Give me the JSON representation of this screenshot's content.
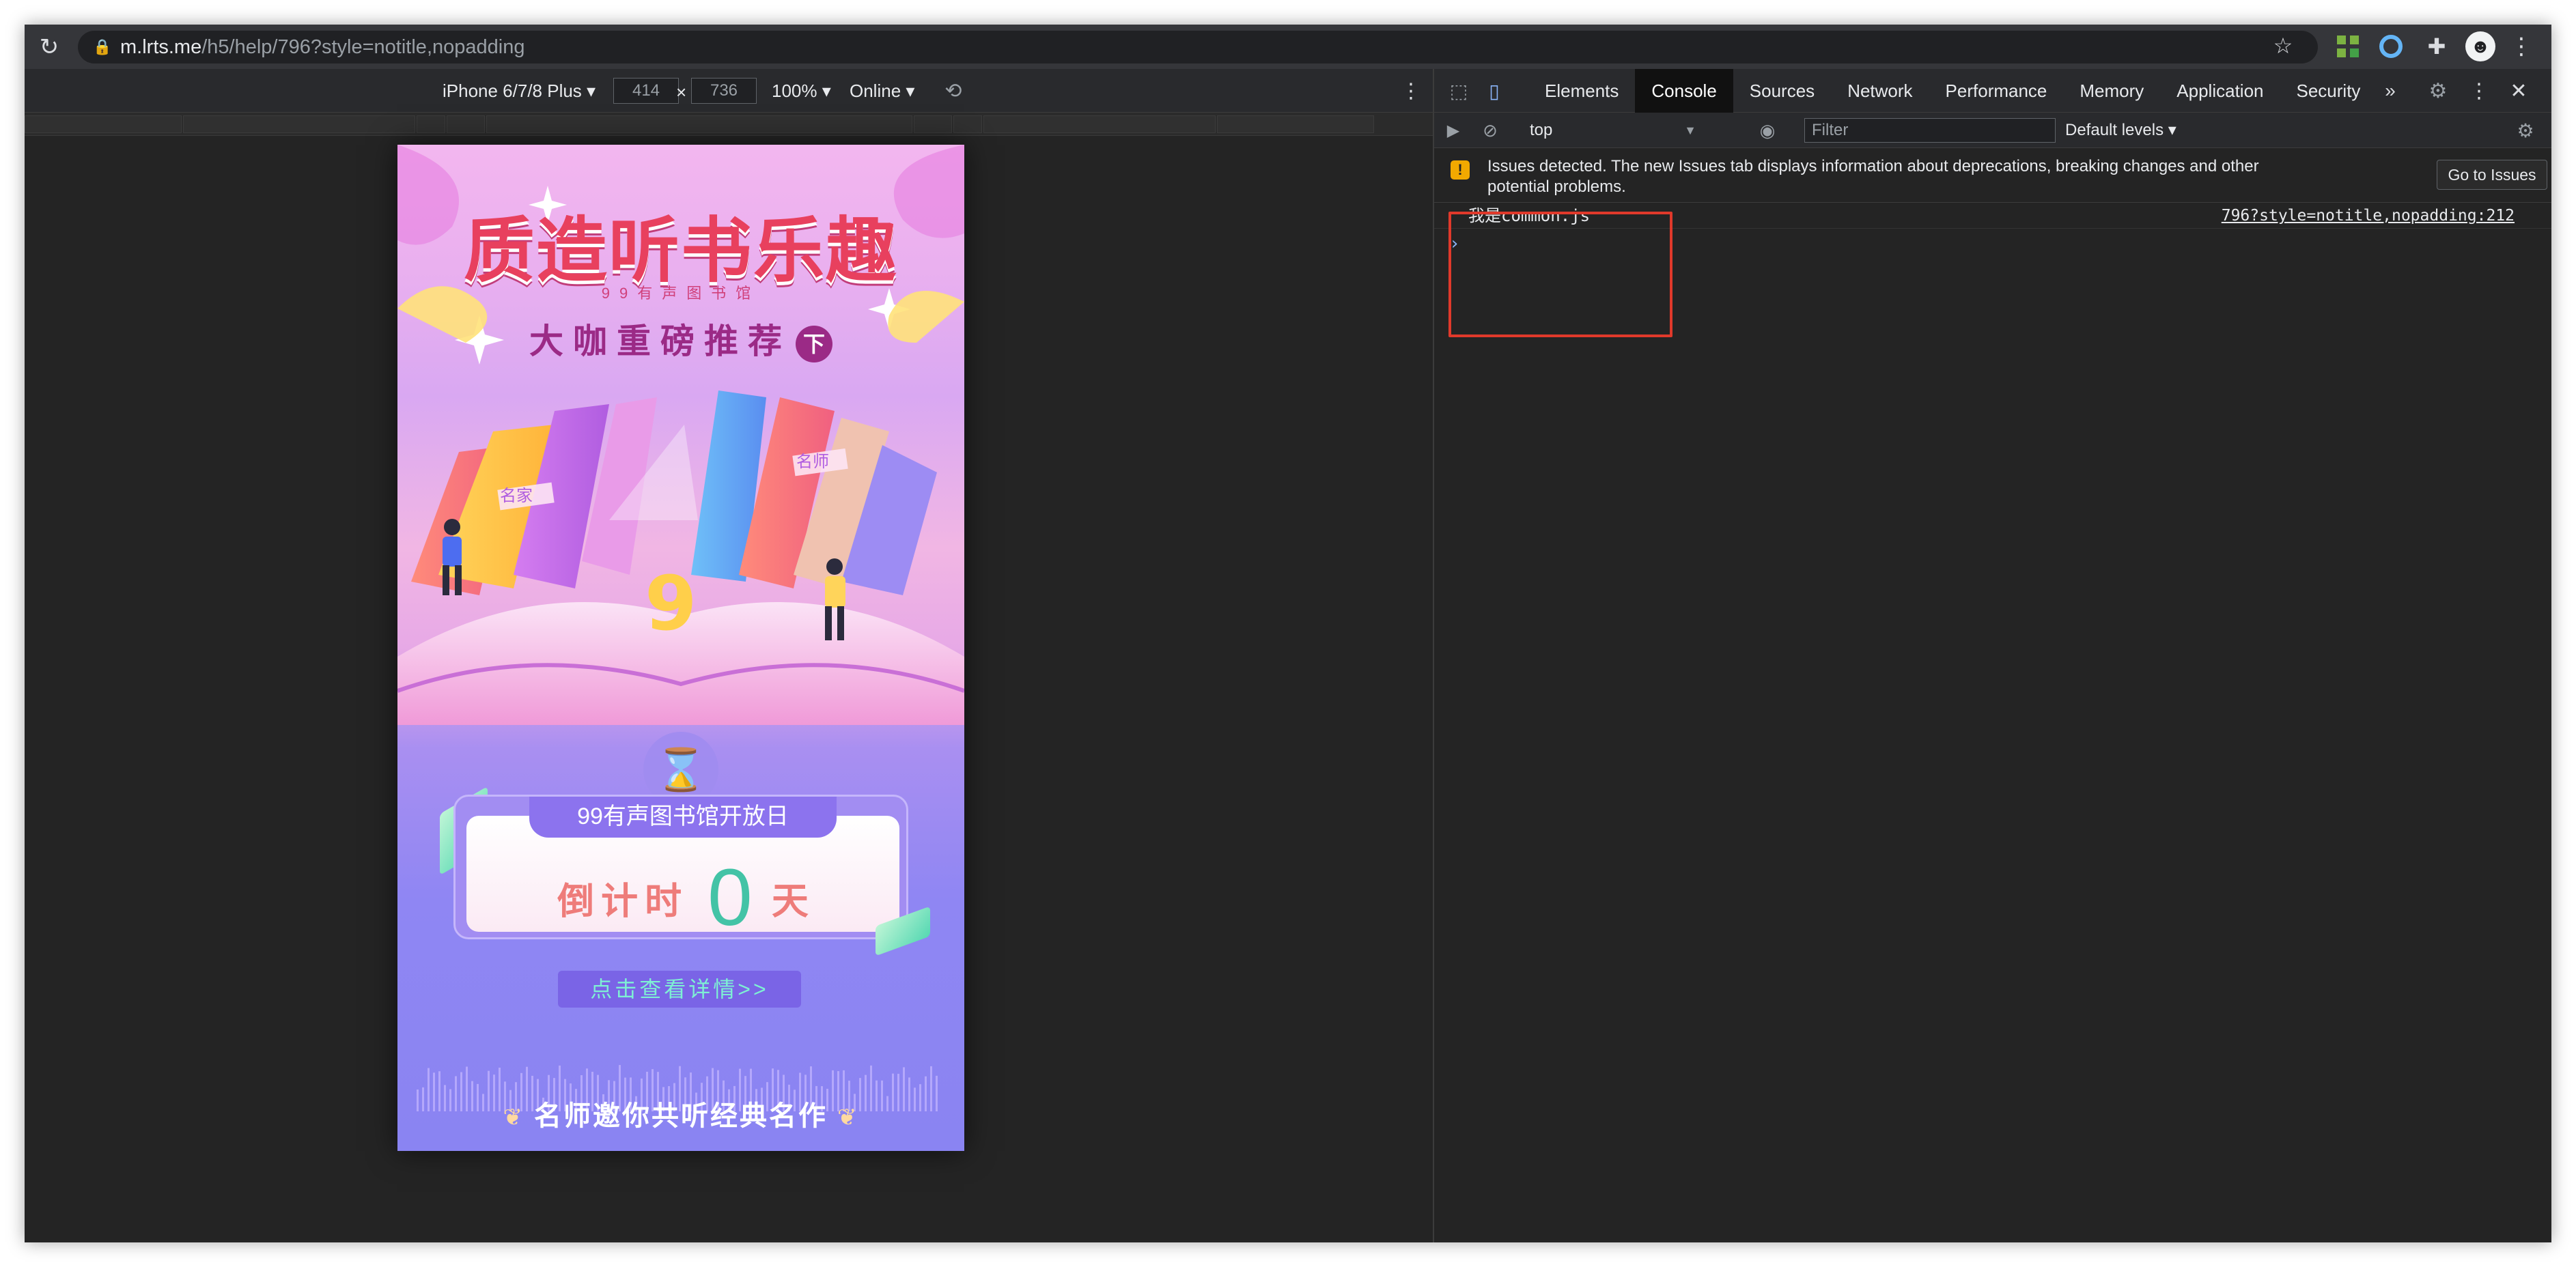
{
  "browser": {
    "url_host": "m.lrts.me",
    "url_path": "/h5/help/796?style=notitle,nopadding",
    "reload_icon": "reload-icon",
    "lock_icon": "lock-icon",
    "star_icon": "star-icon",
    "ext_qr_icon": "qr-code-icon",
    "ext_ring_icon": "ring-extension-icon",
    "ext_puzzle_icon": "puzzle-icon",
    "avatar_glyph": "☻",
    "menu_glyph": "⋮"
  },
  "device_toolbar": {
    "device": "iPhone 6/7/8 Plus ▾",
    "width": "414",
    "height": "736",
    "times": "×",
    "zoom": "100% ▾",
    "throttle": "Online ▾",
    "rotate_glyph": "⟲",
    "menu_glyph": "⋮"
  },
  "phone": {
    "title": "质造听书乐趣",
    "subtitle": "99有声图书馆",
    "tagline": "大咖重磅推荐",
    "tag_badge": "下",
    "art_label_left": "名家",
    "art_label_right": "名师",
    "art_logo": "9",
    "hourglass_glyph": "⌛",
    "countdown_header": "99有声图书馆开放日",
    "countdown_label": "倒计时",
    "countdown_value": "0",
    "countdown_unit": "天",
    "detail_button": "点击查看详情>>",
    "footer_text": "名师邀你共听经典名作",
    "footer_leaf": "❦"
  },
  "devtools": {
    "tabs": [
      "Elements",
      "Console",
      "Sources",
      "Network",
      "Performance",
      "Memory",
      "Application",
      "Security"
    ],
    "active_tab": "Console",
    "more_tabs_glyph": "»",
    "gear_glyph": "⚙",
    "menu_glyph": "⋮",
    "close_glyph": "✕",
    "console": {
      "context": "top",
      "context_arrow": "▼",
      "filter_placeholder": "Filter",
      "levels": "Default levels ▾",
      "issues_icon": "!",
      "issues_text": "Issues detected. The new Issues tab displays information about deprecations, breaking changes and other potential problems.",
      "issues_button": "Go to Issues",
      "issues_close": "✕",
      "log_message": "我是common.js",
      "log_source": "796?style=notitle,nopadding:212",
      "prompt_glyph": "›"
    }
  },
  "colors": {
    "highlight_box": "#e0392b",
    "accent_blue": "#8ab4f8",
    "countdown_green": "#43c3a6"
  }
}
